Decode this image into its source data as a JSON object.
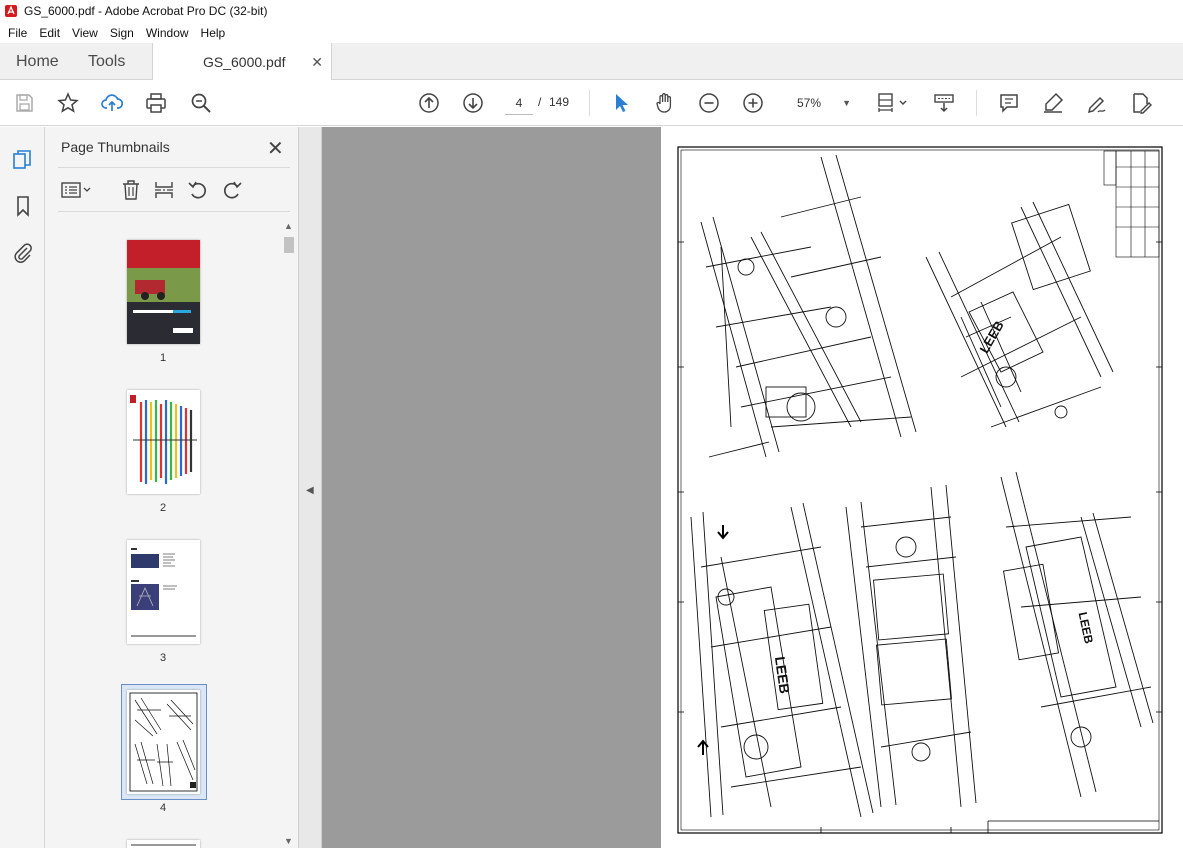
{
  "window": {
    "title": "GS_6000.pdf - Adobe Acrobat Pro DC (32-bit)"
  },
  "menu": [
    "File",
    "Edit",
    "View",
    "Sign",
    "Window",
    "Help"
  ],
  "tabs": {
    "home": "Home",
    "tools": "Tools",
    "document": "GS_6000.pdf"
  },
  "toolbar": {
    "page_current": "4",
    "page_separator": "/",
    "page_total": "149",
    "zoom": "57%",
    "icons": [
      "save-icon",
      "star-icon",
      "upload-cloud-icon",
      "print-icon",
      "find-zoom-icon",
      "prev-page-icon",
      "next-page-icon",
      "select-cursor-icon",
      "hand-icon",
      "zoom-out-icon",
      "zoom-in-icon",
      "page-fit-icon",
      "scroll-mode-icon",
      "comment-icon",
      "highlight-icon",
      "sign-icon",
      "edit-pdf-icon"
    ]
  },
  "sidebar": {
    "panel_title": "Page Thumbnails",
    "thumbnails": [
      {
        "label": "1"
      },
      {
        "label": "2"
      },
      {
        "label": "3"
      },
      {
        "label": "4",
        "selected": true
      }
    ]
  },
  "colors": {
    "accent_blue": "#2a7fd4",
    "selection": "#dbe7f6",
    "doc_bg": "#9b9b9b"
  }
}
